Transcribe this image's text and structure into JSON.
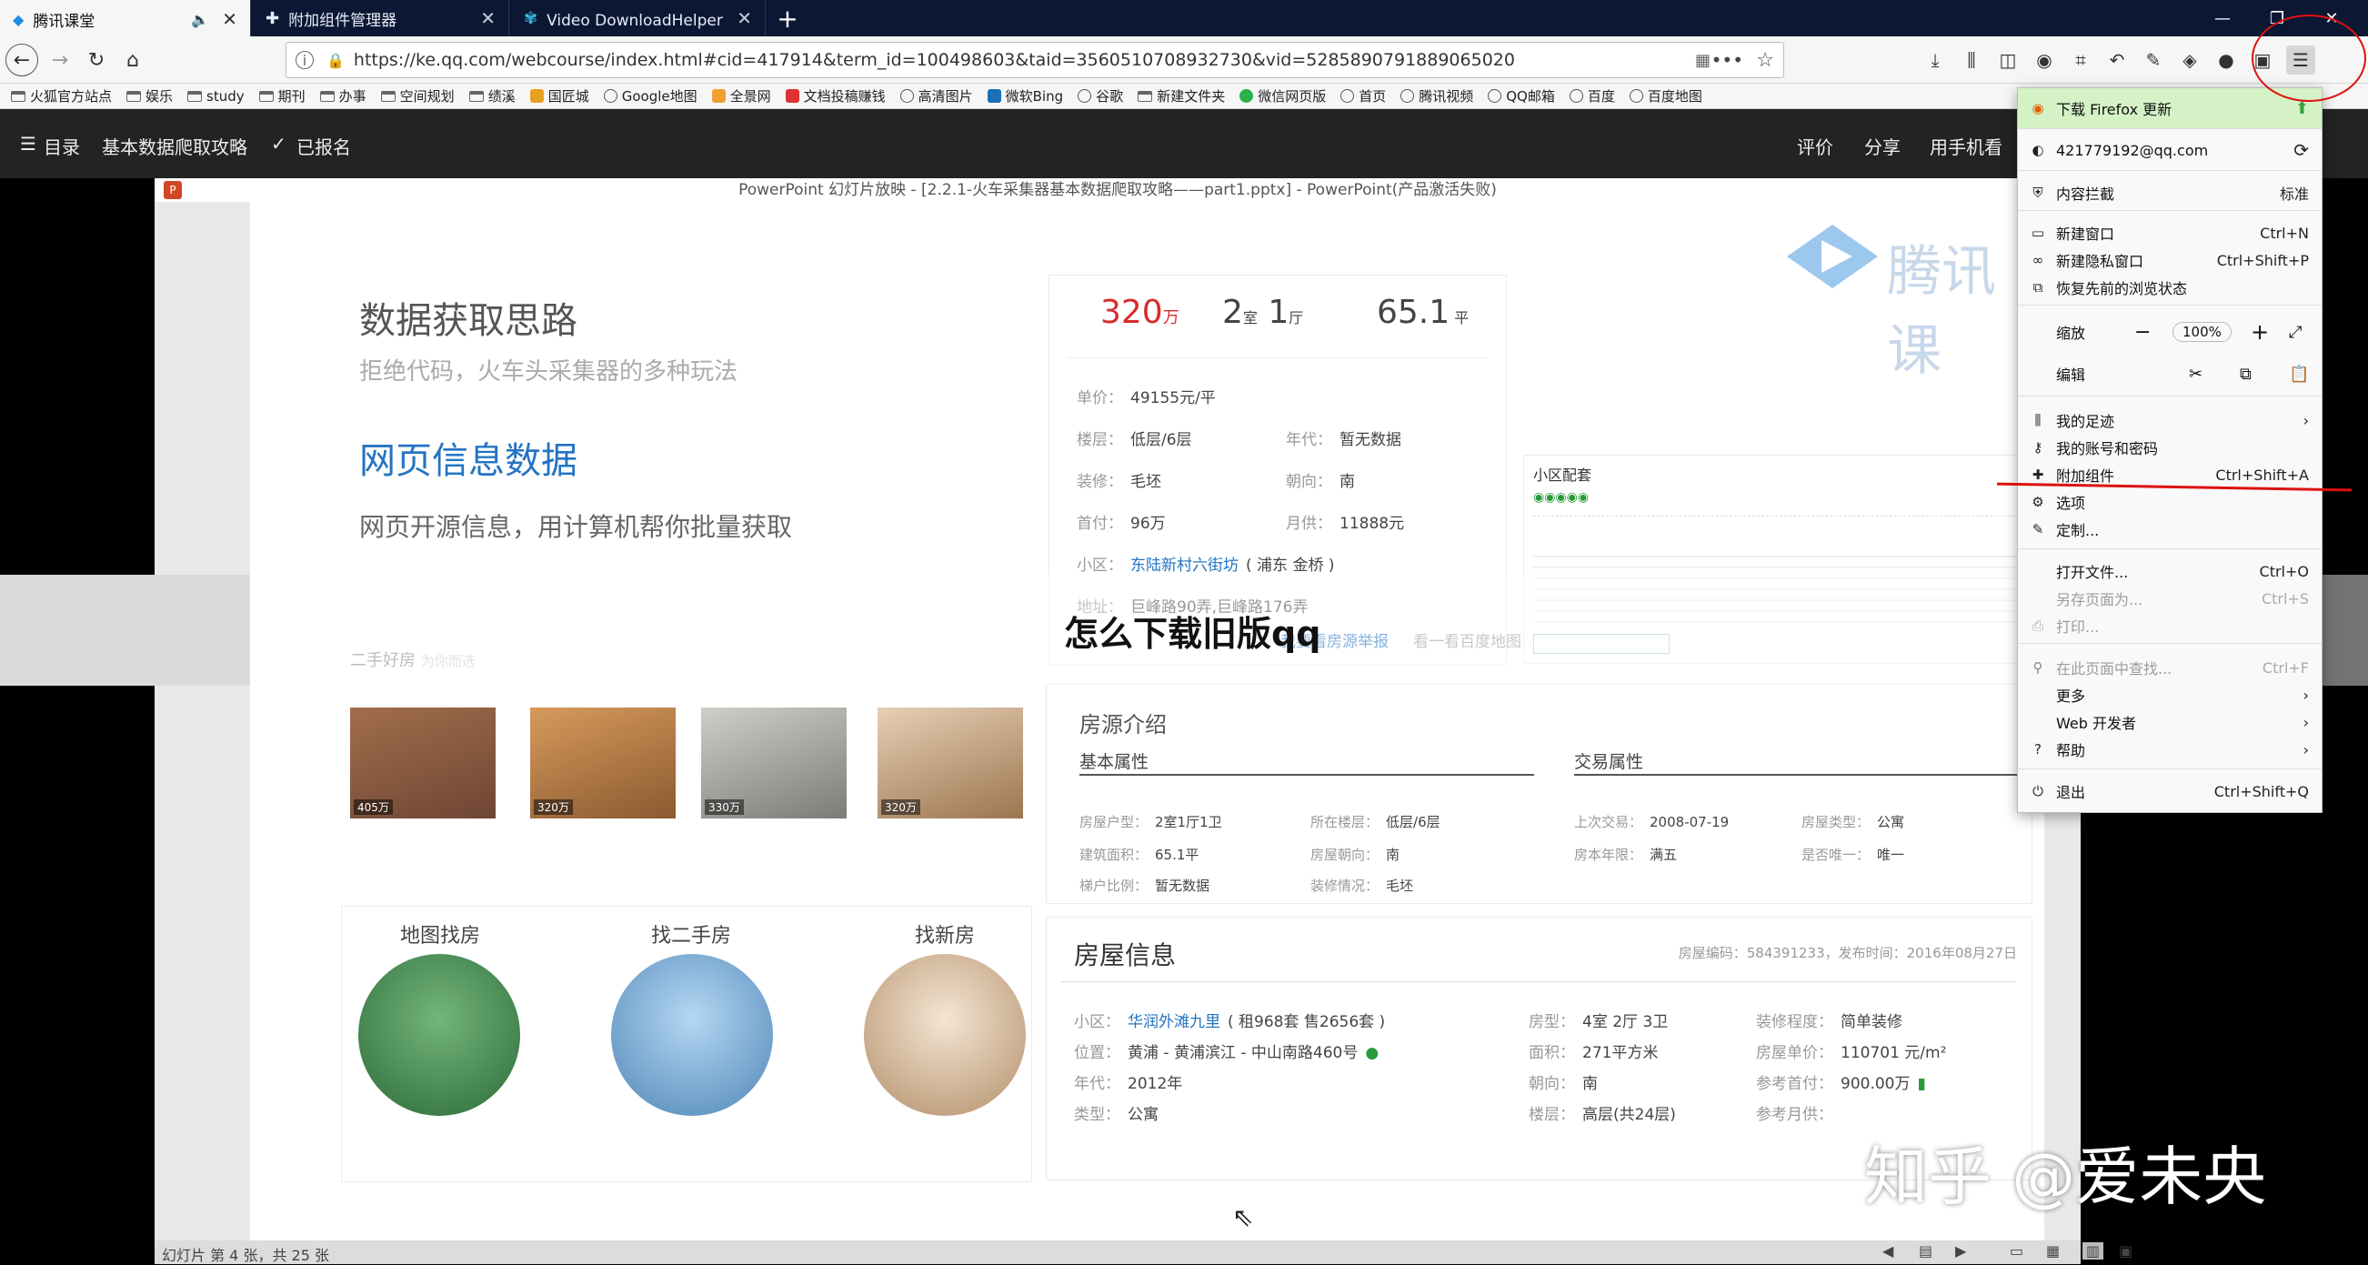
{
  "tabs": [
    {
      "title": "腾讯课堂",
      "icon": "tencent-classroom-icon",
      "active": true
    },
    {
      "title": "附加组件管理器",
      "icon": "puzzle-icon",
      "active": false
    },
    {
      "title": "Video DownloadHelper – 下载",
      "icon": "video-downloadhelper-icon",
      "active": false
    }
  ],
  "url": "https://ke.qq.com/webcourse/index.html#cid=417914&term_id=100498603&taid=3560510708932730&vid=5285890791889065020",
  "bookmarks": [
    "火狐官方站点",
    "娱乐",
    "study",
    "期刊",
    "办事",
    "空间规划",
    "绩溪",
    "国匠城",
    "Google地图",
    "全景网",
    "文档投稿赚钱",
    "高清图片",
    "微软Bing",
    "谷歌",
    "新建文件夹",
    "微信网页版",
    "首页",
    "腾讯视频",
    "QQ邮箱",
    "百度",
    "百度地图"
  ],
  "site": {
    "menu": "目录",
    "course": "基本数据爬取攻略",
    "enrolled": "已报名",
    "rate": "评价",
    "share": "分享",
    "mobile": "用手机看"
  },
  "ppt": {
    "window_title": "PowerPoint 幻灯片放映 - [2.2.1-火车采集器基本数据爬取攻略——part1.pptx] - PowerPoint(产品激活失败)",
    "heading": "数据获取思路",
    "subheading": "拒绝代码，火车头采集器的多种玩法",
    "section": "网页信息数据",
    "desc": "网页开源信息，用计算机帮你批量获取",
    "logo_text": "腾讯课",
    "status": "幻灯片 第 4 张，共 25 张"
  },
  "house": {
    "price": "320",
    "price_unit": "万",
    "rooms": "2",
    "rooms_unit": "室",
    "halls": "1",
    "halls_unit": "厅",
    "area": "65.1",
    "area_unit": "平",
    "unit_price_l": "单价：",
    "unit_price": "49155元/平",
    "floor_l": "楼层：",
    "floor": "低层/6层",
    "year_l": "年代：",
    "year": "暂无数据",
    "deco_l": "装修：",
    "deco": "毛坯",
    "facing_l": "朝向：",
    "facing": "南",
    "down_l": "首付：",
    "down": "96万",
    "monthly_l": "月供：",
    "monthly": "11888元",
    "xq_l": "小区：",
    "xq": "东陆新村六街坊",
    "xq_area": "( 浦东 金桥 )",
    "addr_l": "地址：",
    "addr": "巨峰路90弄,巨峰路176弄",
    "report": "我要看房源举报",
    "report2": "看一看百度地图",
    "amenities_title": "小区配套",
    "list_title": "二手好房",
    "list_sub": "为你而选"
  },
  "listings": [
    {
      "price": "405万",
      "color": "#8a5a3c"
    },
    {
      "price": "320万",
      "color": "#b3733c"
    },
    {
      "price": "330万",
      "color": "#8e8e8a"
    },
    {
      "price": "320万",
      "color": "#c7a07a"
    }
  ],
  "features": [
    {
      "title": "地图找房",
      "color": "#3a8f5a"
    },
    {
      "title": "找二手房",
      "color": "#5a8ec7"
    },
    {
      "title": "找新房",
      "color": "#c7a07a"
    }
  ],
  "intro": {
    "title": "房源介绍",
    "basic": "基本属性",
    "trade": "交易属性",
    "rows": [
      [
        "房屋户型：",
        "2室1厅1卫",
        "所在楼层：",
        "低层/6层",
        "上次交易：",
        "2008-07-19",
        "房屋类型：",
        "公寓"
      ],
      [
        "建筑面积：",
        "65.1平",
        "房屋朝向：",
        "南",
        "房本年限：",
        "满五",
        "是否唯一：",
        "唯一"
      ],
      [
        "梯户比例：",
        "暂无数据",
        "装修情况：",
        "毛坯",
        "",
        "",
        "",
        ""
      ]
    ]
  },
  "info": {
    "title": "房屋信息",
    "code": "房屋编码：584391233，发布时间：2016年08月27日",
    "l1": "小区：",
    "xq": "华润外滩九里",
    "xq2": "( 租968套 售2656套 )",
    "l2": "位置：",
    "pos": "黄浦 - 黄浦滨江 - 中山南路460号",
    "l3": "年代：",
    "year": "2012年",
    "l4": "类型：",
    "type": "公寓",
    "m1": "房型：",
    "layout": "4室 2厅 3卫",
    "m2": "面积：",
    "area": "271平方米",
    "m3": "朝向：",
    "facing": "南",
    "m4": "楼层：",
    "floor": "高层(共24层)",
    "r1": "装修程度：",
    "deco": "简单装修",
    "r2": "房屋单价：",
    "uprice": "110701 元/m²",
    "r3": "参考首付：",
    "down": "900.00万",
    "r4": "参考月供："
  },
  "caption": "怎么下载旧版qq",
  "watermark": "知乎 @爱未央",
  "menu": {
    "update": "下载 Firefox 更新",
    "account": "421779192@qq.com",
    "blocking": "内容拦截",
    "blocking_val": "标准",
    "new_window": "新建窗口",
    "new_window_sc": "Ctrl+N",
    "private": "新建隐私窗口",
    "private_sc": "Ctrl+Shift+P",
    "restore": "恢复先前的浏览状态",
    "zoom": "缩放",
    "zoom_val": "100%",
    "edit": "编辑",
    "library": "我的足迹",
    "logins": "我的账号和密码",
    "addons": "附加组件",
    "addons_sc": "Ctrl+Shift+A",
    "options": "选项",
    "customize": "定制...",
    "open_file": "打开文件...",
    "open_file_sc": "Ctrl+O",
    "save_as": "另存页面为...",
    "save_as_sc": "Ctrl+S",
    "print": "打印...",
    "find": "在此页面中查找...",
    "find_sc": "Ctrl+F",
    "more": "更多",
    "webdev": "Web 开发者",
    "help": "帮助",
    "quit": "退出",
    "quit_sc": "Ctrl+Shift+Q"
  }
}
